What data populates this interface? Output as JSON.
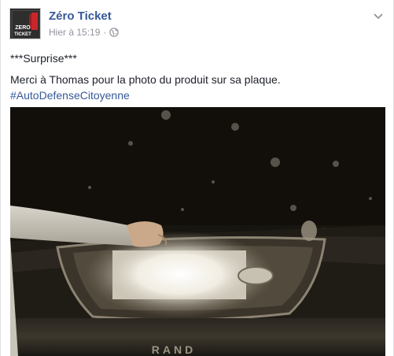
{
  "post": {
    "page_name": "Zéro Ticket",
    "timestamp": "Hier à 15:19",
    "separator": "·",
    "audience_icon": "globe-icon",
    "menu_icon": "chevron-down-icon",
    "avatar_text_top": "ZERO",
    "avatar_text_bottom": "TICKET",
    "text_line_1": "***Surprise***",
    "text_line_2": "Merci à Thomas pour la photo du produit sur sa plaque.",
    "hashtag": "#AutoDefenseCitoyenne",
    "photo_bottom_text": "RAND"
  },
  "colors": {
    "link": "#365899",
    "text": "#1d2129",
    "meta": "#90949c"
  }
}
